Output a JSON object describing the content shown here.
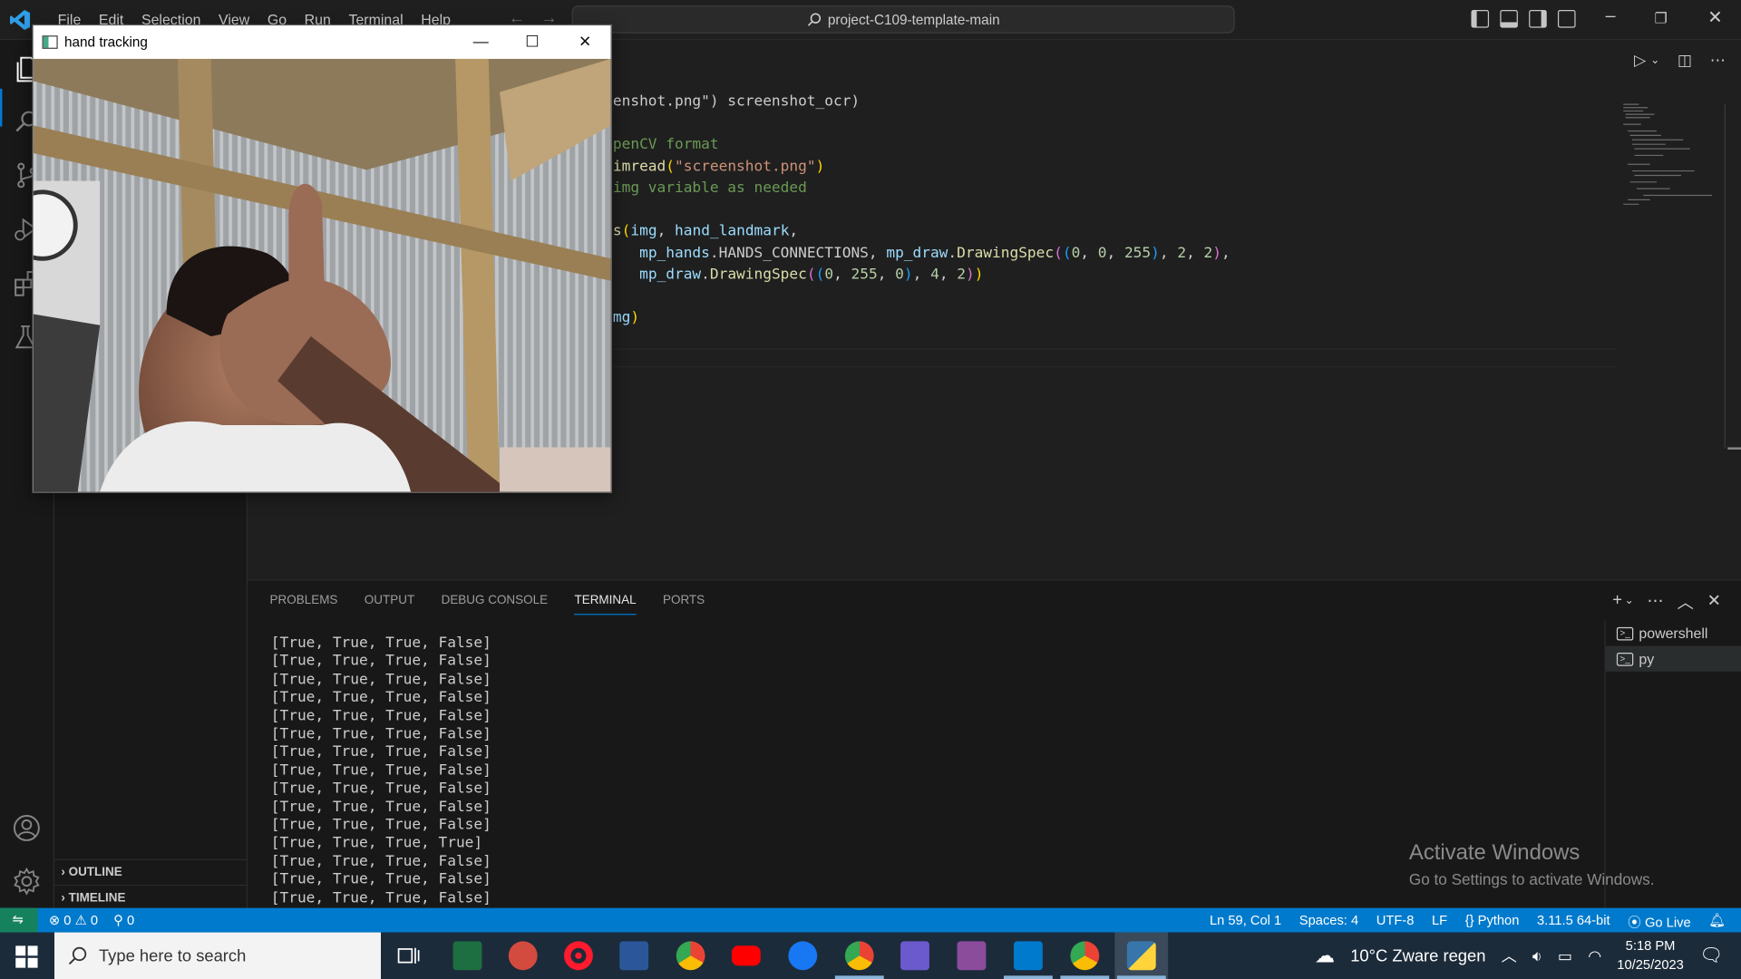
{
  "titlebar": {
    "menu": [
      "File",
      "Edit",
      "Selection",
      "View",
      "Go",
      "Run",
      "Terminal",
      "Help"
    ],
    "search_text": "project-C109-template-main"
  },
  "sidebar": {
    "outline_label": "OUTLINE",
    "timeline_label": "TIMELINE"
  },
  "editor": {
    "lines": [
      {
        "segments": [
          [
            "c-p",
            "enshot.png\") screenshot_ocr)"
          ]
        ]
      },
      {
        "segments": [
          [
            "c-p",
            ""
          ]
        ]
      },
      {
        "segments": [
          [
            "c-com",
            "penCV format"
          ]
        ]
      },
      {
        "segments": [
          [
            "c-fn",
            "imread"
          ],
          [
            "c-b1",
            "("
          ],
          [
            "c-str",
            "\"screenshot.png\""
          ],
          [
            "c-b1",
            ")"
          ]
        ]
      },
      {
        "segments": [
          [
            "c-com",
            "img variable as needed"
          ]
        ]
      },
      {
        "segments": [
          [
            "c-p",
            ""
          ]
        ]
      },
      {
        "segments": [
          [
            "c-fn",
            "s"
          ],
          [
            "c-b1",
            "("
          ],
          [
            "c-var",
            "img"
          ],
          [
            "c-p",
            ", "
          ],
          [
            "c-var",
            "hand_landmark"
          ],
          [
            "c-p",
            ","
          ]
        ]
      },
      {
        "segments": [
          [
            "c-p",
            "   "
          ],
          [
            "c-var",
            "mp_hands"
          ],
          [
            "c-p",
            ".HANDS_CONNECTIONS, "
          ],
          [
            "c-var",
            "mp_draw"
          ],
          [
            "c-p",
            "."
          ],
          [
            "c-fn",
            "DrawingSpec"
          ],
          [
            "c-b2",
            "("
          ],
          [
            "c-b3",
            "("
          ],
          [
            "c-num",
            "0"
          ],
          [
            "c-p",
            ", "
          ],
          [
            "c-num",
            "0"
          ],
          [
            "c-p",
            ", "
          ],
          [
            "c-num",
            "255"
          ],
          [
            "c-b3",
            ")"
          ],
          [
            "c-p",
            ", "
          ],
          [
            "c-num",
            "2"
          ],
          [
            "c-p",
            ", "
          ],
          [
            "c-num",
            "2"
          ],
          [
            "c-b2",
            ")"
          ],
          [
            "c-p",
            ","
          ]
        ]
      },
      {
        "segments": [
          [
            "c-p",
            "   "
          ],
          [
            "c-var",
            "mp_draw"
          ],
          [
            "c-p",
            "."
          ],
          [
            "c-fn",
            "DrawingSpec"
          ],
          [
            "c-b2",
            "("
          ],
          [
            "c-b3",
            "("
          ],
          [
            "c-num",
            "0"
          ],
          [
            "c-p",
            ", "
          ],
          [
            "c-num",
            "255"
          ],
          [
            "c-p",
            ", "
          ],
          [
            "c-num",
            "0"
          ],
          [
            "c-b3",
            ")"
          ],
          [
            "c-p",
            ", "
          ],
          [
            "c-num",
            "4"
          ],
          [
            "c-p",
            ", "
          ],
          [
            "c-num",
            "2"
          ],
          [
            "c-b2",
            ")"
          ],
          [
            "c-b1",
            ")"
          ]
        ]
      },
      {
        "segments": [
          [
            "c-p",
            ""
          ]
        ]
      },
      {
        "segments": [
          [
            "c-var",
            "mg"
          ],
          [
            "c-b1",
            ")"
          ]
        ]
      }
    ]
  },
  "panel": {
    "tabs": [
      "PROBLEMS",
      "OUTPUT",
      "DEBUG CONSOLE",
      "TERMINAL",
      "PORTS"
    ],
    "active_tab": "TERMINAL",
    "terminal_lines": [
      "[True, True, True, False]",
      "[True, True, True, False]",
      "[True, True, True, False]",
      "[True, True, True, False]",
      "[True, True, True, False]",
      "[True, True, True, False]",
      "[True, True, True, False]",
      "[True, True, True, False]",
      "[True, True, True, False]",
      "[True, True, True, False]",
      "[True, True, True, False]",
      "[True, True, True, True]",
      "[True, True, True, False]",
      "[True, True, True, False]",
      "[True, True, True, False]"
    ],
    "terminals": [
      "powershell",
      "py"
    ],
    "watermark_title": "Activate Windows",
    "watermark_sub": "Go to Settings to activate Windows."
  },
  "statusbar": {
    "errors": "0",
    "warnings": "0",
    "ports": "0",
    "position": "Ln 59, Col 1",
    "spaces": "Spaces: 4",
    "encoding": "UTF-8",
    "eol": "LF",
    "language": "Python",
    "interpreter": "3.11.5 64-bit",
    "golive": "Go Live"
  },
  "taskbar": {
    "search_placeholder": "Type here to search",
    "weather": "10°C  Zware regen",
    "time": "5:18 PM",
    "date": "10/25/2023",
    "accent": "#007acc"
  },
  "cv_window": {
    "title": "hand tracking"
  }
}
